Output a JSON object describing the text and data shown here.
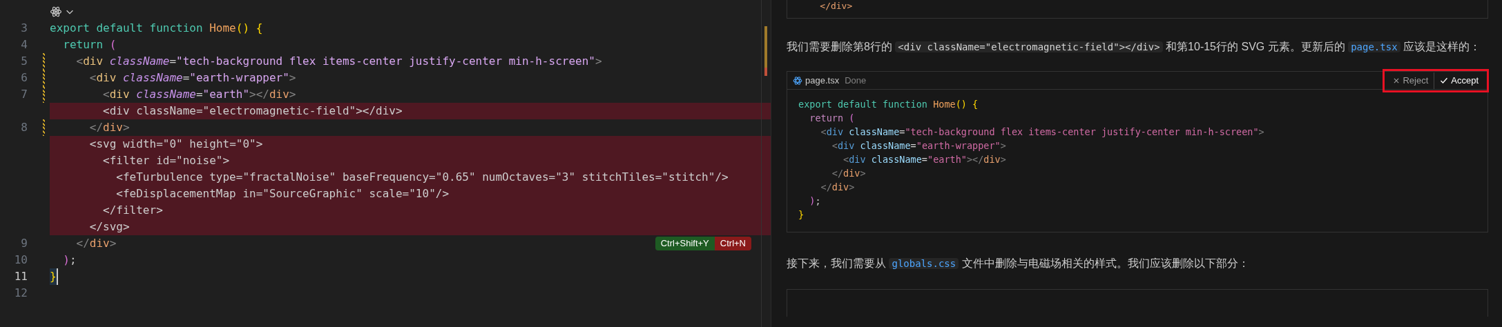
{
  "editor": {
    "lines": [
      {
        "kind": "codelens"
      },
      {
        "kind": "normal",
        "number": "3",
        "modified": false,
        "current": false,
        "text": "export default function Home() {"
      },
      {
        "kind": "normal",
        "number": "4",
        "modified": false,
        "current": false,
        "text": "  return ("
      },
      {
        "kind": "normal",
        "number": "5",
        "modified": true,
        "current": false,
        "text": "    <div className=\"tech-background flex items-center justify-center min-h-screen\">"
      },
      {
        "kind": "normal",
        "number": "6",
        "modified": true,
        "current": false,
        "text": "      <div className=\"earth-wrapper\">"
      },
      {
        "kind": "normal",
        "number": "7",
        "modified": true,
        "current": false,
        "text": "        <div className=\"earth\"></div>"
      },
      {
        "kind": "deleted",
        "text": "        <div className=\"electromagnetic-field\"></div>"
      },
      {
        "kind": "normal",
        "number": "8",
        "modified": true,
        "current": false,
        "text": "      </div>"
      },
      {
        "kind": "deleted",
        "text": "      <svg width=\"0\" height=\"0\">"
      },
      {
        "kind": "deleted",
        "text": "        <filter id=\"noise\">"
      },
      {
        "kind": "deleted",
        "text": "          <feTurbulence type=\"fractalNoise\" baseFrequency=\"0.65\" numOctaves=\"3\" stitchTiles=\"stitch\"/>"
      },
      {
        "kind": "deleted",
        "text": "          <feDisplacementMap in=\"SourceGraphic\" scale=\"10\"/>"
      },
      {
        "kind": "deleted",
        "text": "        </filter>"
      },
      {
        "kind": "deleted",
        "text": "      </svg>"
      },
      {
        "kind": "normal",
        "number": "9",
        "modified": false,
        "current": false,
        "text": "    </div>",
        "shortcuts": [
          {
            "label": "Ctrl+Shift+Y",
            "kind": "keep"
          },
          {
            "label": "Ctrl+N",
            "kind": "undo"
          }
        ]
      },
      {
        "kind": "normal",
        "number": "10",
        "modified": false,
        "current": false,
        "text": "  );"
      },
      {
        "kind": "normal",
        "number": "11",
        "modified": false,
        "current": true,
        "text": "}"
      },
      {
        "kind": "normal",
        "number": "12",
        "modified": false,
        "current": false
      }
    ]
  },
  "chat": {
    "top_block": {
      "line": "    </div>"
    },
    "paragraph_1": [
      {
        "kind": "text",
        "t": "我们需要删除第8行的 "
      },
      {
        "kind": "code",
        "t": "<div className=\"electromagnetic-field\"></div>"
      },
      {
        "kind": "text",
        "t": " 和第10-15行的 SVG 元素。更新后的 "
      },
      {
        "kind": "file",
        "t": "page.tsx"
      },
      {
        "kind": "text",
        "t": " 应该是这样的："
      }
    ],
    "code_block": {
      "filename": "page.tsx",
      "status": "Done",
      "buttons": [
        {
          "label": "Reject",
          "kind": "reject"
        },
        {
          "label": "Accept",
          "kind": "accept"
        }
      ],
      "highlighted": true,
      "lines": [
        "export default function Home() {",
        "  return (",
        "    <div className=\"tech-background flex items-center justify-center min-h-screen\">",
        "      <div className=\"earth-wrapper\">",
        "        <div className=\"earth\"></div>",
        "      </div>",
        "    </div>",
        "  );",
        "}"
      ]
    },
    "paragraph_2": [
      {
        "kind": "text",
        "t": "接下来，我们需要从 "
      },
      {
        "kind": "file",
        "t": "globals.css"
      },
      {
        "kind": "text",
        "t": " 文件中删除与电磁场相关的样式。我们应该删除以下部分："
      }
    ]
  }
}
